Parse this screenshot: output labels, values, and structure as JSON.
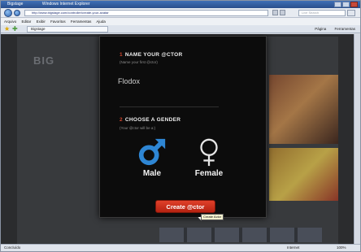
{
  "window": {
    "tabs": [
      "Bigstage",
      "Windows Internet Explorer"
    ]
  },
  "browser": {
    "address": "http://www.bigstage.com/controller/create-your-avatar",
    "search_placeholder": "Live Search",
    "menu": [
      "Arquivo",
      "Editar",
      "Exibir",
      "Favoritos",
      "Ferramentas",
      "Ajuda"
    ],
    "tab_label": "Bigstage",
    "command_items": [
      "Página",
      "Ferramentas"
    ],
    "status_left": "Concluído",
    "status_zone": "Internet",
    "status_zoom": "100%"
  },
  "site": {
    "logo": "BIG"
  },
  "modal": {
    "step1": {
      "number": "1",
      "title": "NAME YOUR @CTOR",
      "hint": "(Name your first @ctor)",
      "value": "Flodox"
    },
    "step2": {
      "number": "2",
      "title": "CHOOSE A GENDER",
      "hint": "(Your @ctor will be a:)"
    },
    "genders": [
      {
        "label": "Male",
        "icon": "male-symbol-icon",
        "color": "#2e86d4"
      },
      {
        "label": "Female",
        "icon": "female-symbol-icon",
        "color": "#e6e6e6"
      }
    ],
    "create_button": "Create @ctor",
    "tooltip": "Create Actor",
    "accent_color": "#d2462e"
  }
}
